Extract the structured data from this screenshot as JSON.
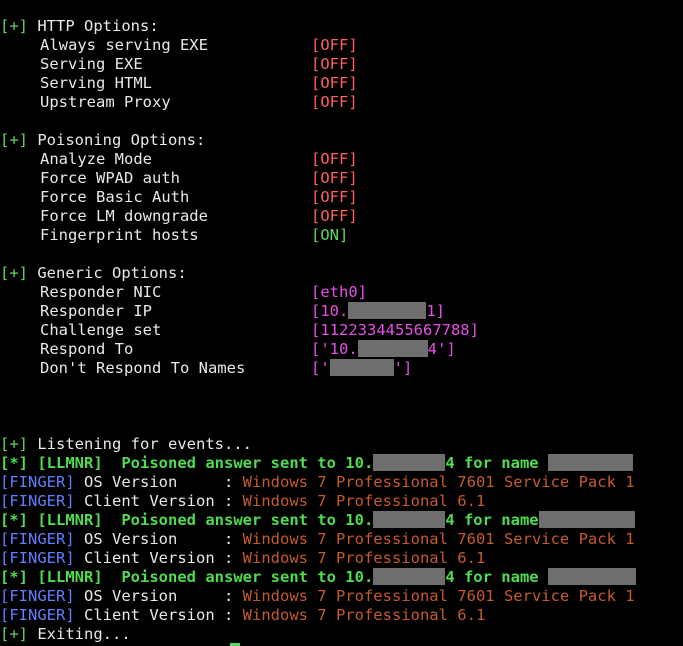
{
  "http": {
    "header_mark": "[+]",
    "header": "HTTP Options:",
    "opts": [
      {
        "name": "Always serving EXE",
        "value": "[OFF]"
      },
      {
        "name": "Serving EXE",
        "value": "[OFF]"
      },
      {
        "name": "Serving HTML",
        "value": "[OFF]"
      },
      {
        "name": "Upstream Proxy",
        "value": "[OFF]"
      }
    ]
  },
  "poison": {
    "header_mark": "[+]",
    "header": "Poisoning Options:",
    "opts": [
      {
        "name": "Analyze Mode",
        "value": "[OFF]"
      },
      {
        "name": "Force WPAD auth",
        "value": "[OFF]"
      },
      {
        "name": "Force Basic Auth",
        "value": "[OFF]"
      },
      {
        "name": "Force LM downgrade",
        "value": "[OFF]"
      },
      {
        "name": "Fingerprint hosts",
        "value": "[ON]"
      }
    ]
  },
  "generic": {
    "header_mark": "[+]",
    "header": "Generic Options:",
    "nic_name": "Responder NIC",
    "nic_value": "[eth0]",
    "ip_name": "Responder IP",
    "ip_prefix": "[10.",
    "ip_suffix": "1]",
    "challenge_name": "Challenge set",
    "challenge_value": "[1122334455667788]",
    "respond_name": "Respond To",
    "respond_prefix": "['10.",
    "respond_suffix": "4']",
    "dont_name": "Don't Respond To Names",
    "dont_prefix": "['",
    "dont_suffix": "']"
  },
  "events": {
    "listening_mark": "[+]",
    "listening": "Listening for events...",
    "poison_mark": "[*]",
    "llmnr_tag": "[LLMNR]",
    "poisoned_text": "Poisoned answer sent to 10.",
    "poisoned_suffix": "4 for name",
    "finger_tag": "[FINGER]",
    "os_label": "OS Version     :",
    "os_value": "Windows 7 Professional 7601 Service Pack 1",
    "client_label": "Client Version :",
    "client_value": "Windows 7 Professional 6.1",
    "exiting_mark": "[+]",
    "exiting": "Exiting..."
  }
}
